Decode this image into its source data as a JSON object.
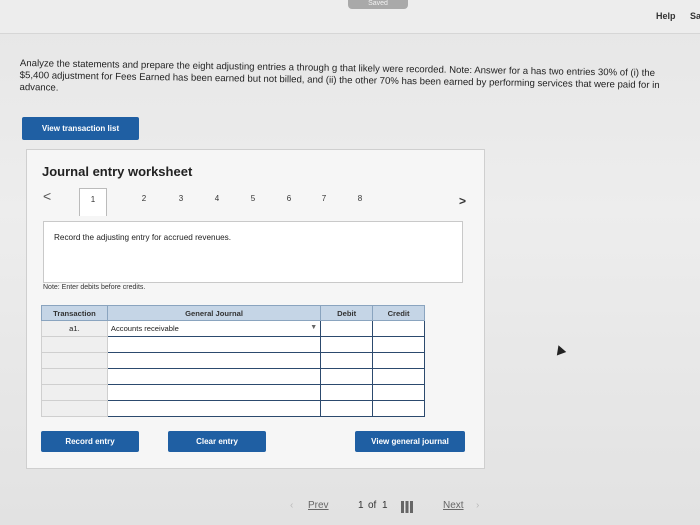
{
  "header": {
    "saved": "Saved",
    "help": "Help",
    "save": "Sa"
  },
  "instructions": "Analyze the statements and prepare the eight adjusting entries a through g that likely were recorded. Note: Answer for a has two entries 30% of (i) the $5,400 adjustment for Fees Earned has been earned but not billed, and (ii) the other 70% has been earned by performing services that were paid for in advance.",
  "view_transaction_list": "View transaction list",
  "worksheet": {
    "title": "Journal entry worksheet",
    "prev": "<",
    "next": ">",
    "tabs": [
      "1",
      "2",
      "3",
      "4",
      "5",
      "6",
      "7",
      "8"
    ],
    "active_tab": "1",
    "prompt": "Record the adjusting entry for accrued revenues.",
    "note": "Note: Enter debits before credits.",
    "columns": [
      "Transaction",
      "General Journal",
      "Debit",
      "Credit"
    ],
    "rows": [
      {
        "transaction": "a1.",
        "account": "Accounts receivable",
        "debit": "",
        "credit": ""
      },
      {
        "transaction": "",
        "account": "",
        "debit": "",
        "credit": ""
      },
      {
        "transaction": "",
        "account": "",
        "debit": "",
        "credit": ""
      },
      {
        "transaction": "",
        "account": "",
        "debit": "",
        "credit": ""
      },
      {
        "transaction": "",
        "account": "",
        "debit": "",
        "credit": ""
      },
      {
        "transaction": "",
        "account": "",
        "debit": "",
        "credit": ""
      }
    ],
    "buttons": {
      "record": "Record entry",
      "clear": "Clear entry",
      "view_general": "View general journal"
    }
  },
  "pager": {
    "prev": "Prev",
    "page": "1",
    "of_label": "of",
    "total": "1",
    "next": "Next"
  },
  "colors": {
    "primary_button": "#1f5fa3",
    "table_header": "#c5d5e6"
  }
}
